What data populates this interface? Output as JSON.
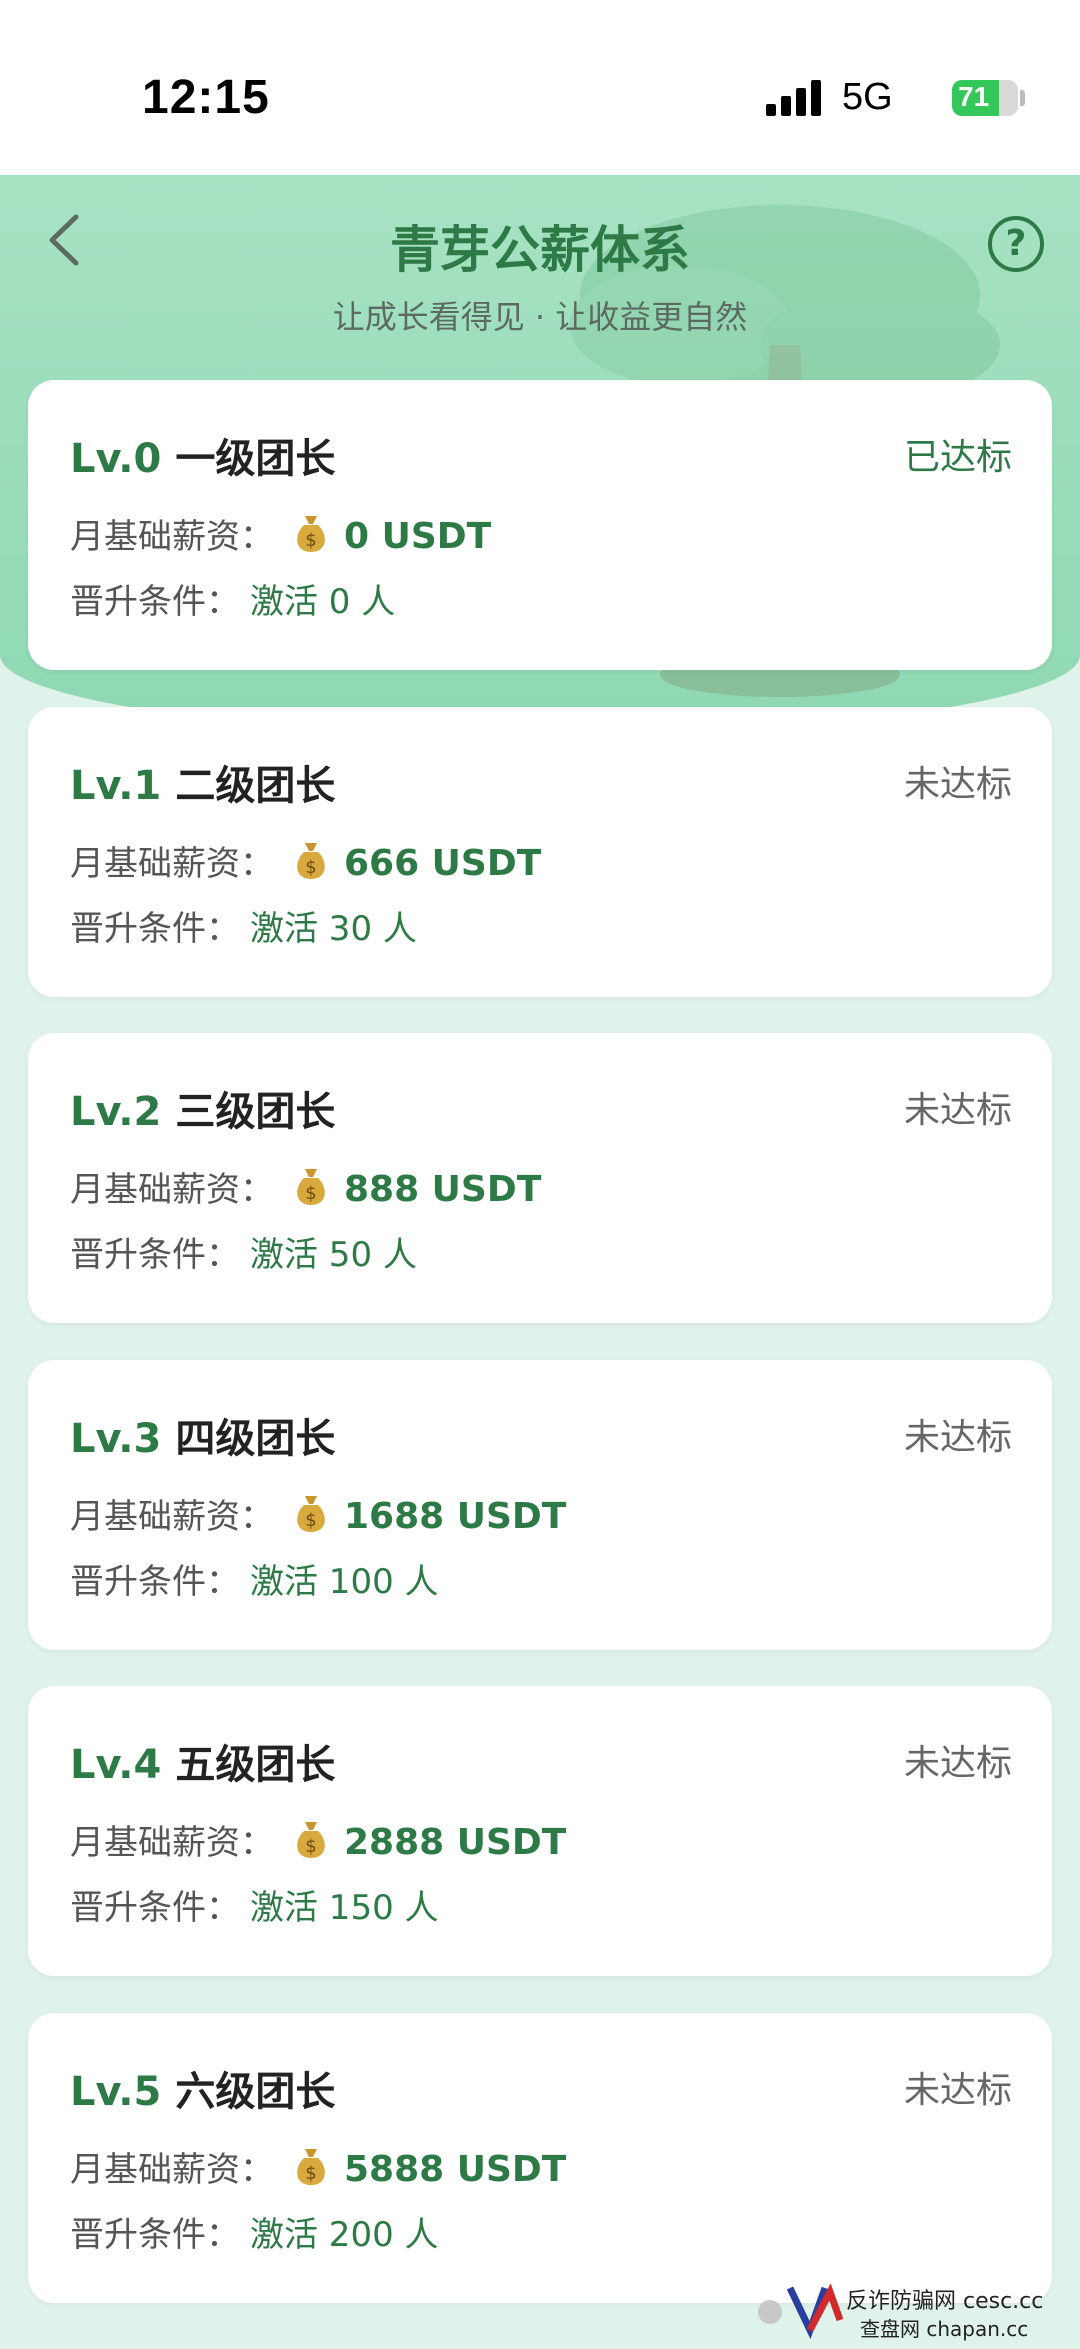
{
  "status_bar": {
    "time": "12:15",
    "network": "5G",
    "battery": "71",
    "battery_level": 0.71
  },
  "header": {
    "title": "青芽公薪体系",
    "subtitle": "让成长看得见 · 让收益更自然",
    "back_icon": "chevron-left-icon",
    "help_icon": "question-circle-icon",
    "help_text": "?"
  },
  "labels": {
    "salary": "月基础薪资：",
    "condition": "晋升条件："
  },
  "levels": [
    {
      "code": "Lv.0",
      "name": "一级团长",
      "status": "已达标",
      "salary": "0 USDT",
      "condition": "激活 0 人"
    },
    {
      "code": "Lv.1",
      "name": "二级团长",
      "status": "未达标",
      "salary": "666 USDT",
      "condition": "激活 30 人"
    },
    {
      "code": "Lv.2",
      "name": "三级团长",
      "status": "未达标",
      "salary": "888 USDT",
      "condition": "激活 50 人"
    },
    {
      "code": "Lv.3",
      "name": "四级团长",
      "status": "未达标",
      "salary": "1688 USDT",
      "condition": "激活 100 人"
    },
    {
      "code": "Lv.4",
      "name": "五级团长",
      "status": "未达标",
      "salary": "2888 USDT",
      "condition": "激活 150 人"
    },
    {
      "code": "Lv.5",
      "name": "六级团长",
      "status": "未达标",
      "salary": "5888 USDT",
      "condition": "激活 200 人"
    }
  ],
  "watermark": {
    "line1": "反诈防骗网 cesc.cc",
    "line2": "查盘网 chapan.cc"
  },
  "colors": {
    "accent": "#2e7a47",
    "achieved": "#2e7a47",
    "not_achieved": "#666666",
    "header_bg": "#a7e2c3"
  }
}
